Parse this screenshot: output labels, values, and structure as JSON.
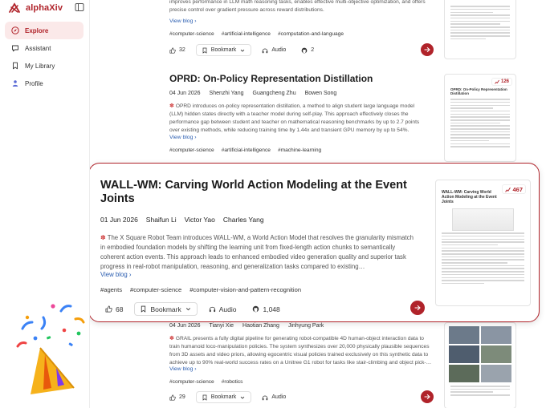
{
  "brand": {
    "name": "alphaXiv"
  },
  "nav": [
    {
      "label": "Explore",
      "icon": "compass-icon",
      "active": true
    },
    {
      "label": "Assistant",
      "icon": "chat-bubble-icon",
      "active": false
    },
    {
      "label": "My Library",
      "icon": "bookmark-icon",
      "active": false
    },
    {
      "label": "Profile",
      "icon": "person-icon",
      "active": false
    }
  ],
  "top_card": {
    "desc": [
      "improves performance in LLM math reasoning tasks, enables effective multi-objective optimization, and offers",
      "precise control over gradient pressure across reward distributions."
    ],
    "view_blog": "View blog ›",
    "tags": [
      "#computer-science",
      "#artificial-intelligence",
      "#computation-and-language"
    ],
    "likes": "32",
    "bookmark": "Bookmark",
    "audio": "Audio",
    "github": "2"
  },
  "card2": {
    "title": "OPRD: On-Policy Representation Distillation",
    "date": "04 Jun 2026",
    "authors": [
      "Shenzhi Yang",
      "Guangcheng Zhu",
      "Bowen Song"
    ],
    "desc": "OPRD introduces on-policy representation distillation, a method to align student large language model (LLM) hidden states directly with a teacher model during self-play. This approach effectively closes the performance gap between student and teacher on mathematical reasoning benchmarks by up to 2.7 points over existing methods, while reducing training time by 1.44x and transient GPU memory by up to 54%.",
    "view_blog": "View blog ›",
    "tags": [
      "#computer-science",
      "#artificial-intelligence",
      "#machine-learning"
    ],
    "badge": "126",
    "thumb_title": "OPRD: On-Policy Representation Distillation"
  },
  "featured": {
    "title": "WALL-WM: Carving World Action Modeling at the Event Joints",
    "date": "01 Jun 2026",
    "authors": [
      "Shaifun Li",
      "Victor Yao",
      "Charles Yang"
    ],
    "desc": "The X Square Robot Team introduces WALL-WM, a World Action Model that resolves the granularity mismatch in embodied foundation models by shifting the learning unit from fixed-length action chunks to semantically coherent action events. This approach leads to enhanced embodied video generation quality and superior task progress in real-robot manipulation, reasoning, and generalization tasks compared to existing…",
    "view_blog": "View blog ›",
    "tags": [
      "#agents",
      "#computer-science",
      "#computer-vision-and-pattern-recognition"
    ],
    "likes": "68",
    "bookmark": "Bookmark",
    "audio": "Audio",
    "github": "1,048",
    "badge": "467",
    "thumb_title": "WALL-WM: Carving World Action Modeling at the Event Joints"
  },
  "card4": {
    "date": "04 Jun 2026",
    "authors": [
      "Tianyi Xie",
      "Haotian Zhang",
      "Jinhyung Park"
    ],
    "desc": "GRAIL presents a fully digital pipeline for generating robot-compatible 4D human-object interaction data to train humanoid loco-manipulation policies. The system synthesizes over 20,000 physically plausible sequences from 3D assets and video priors, allowing egocentric visual policies trained exclusively on this synthetic data to achieve up to 90% real-world success rates on a Unitree G1 robot for tasks like stair-climbing and object pick-…",
    "view_blog": "View blog ›",
    "tags": [
      "#computer-science",
      "#robotics"
    ],
    "likes": "29",
    "bookmark": "Bookmark",
    "audio": "Audio"
  }
}
